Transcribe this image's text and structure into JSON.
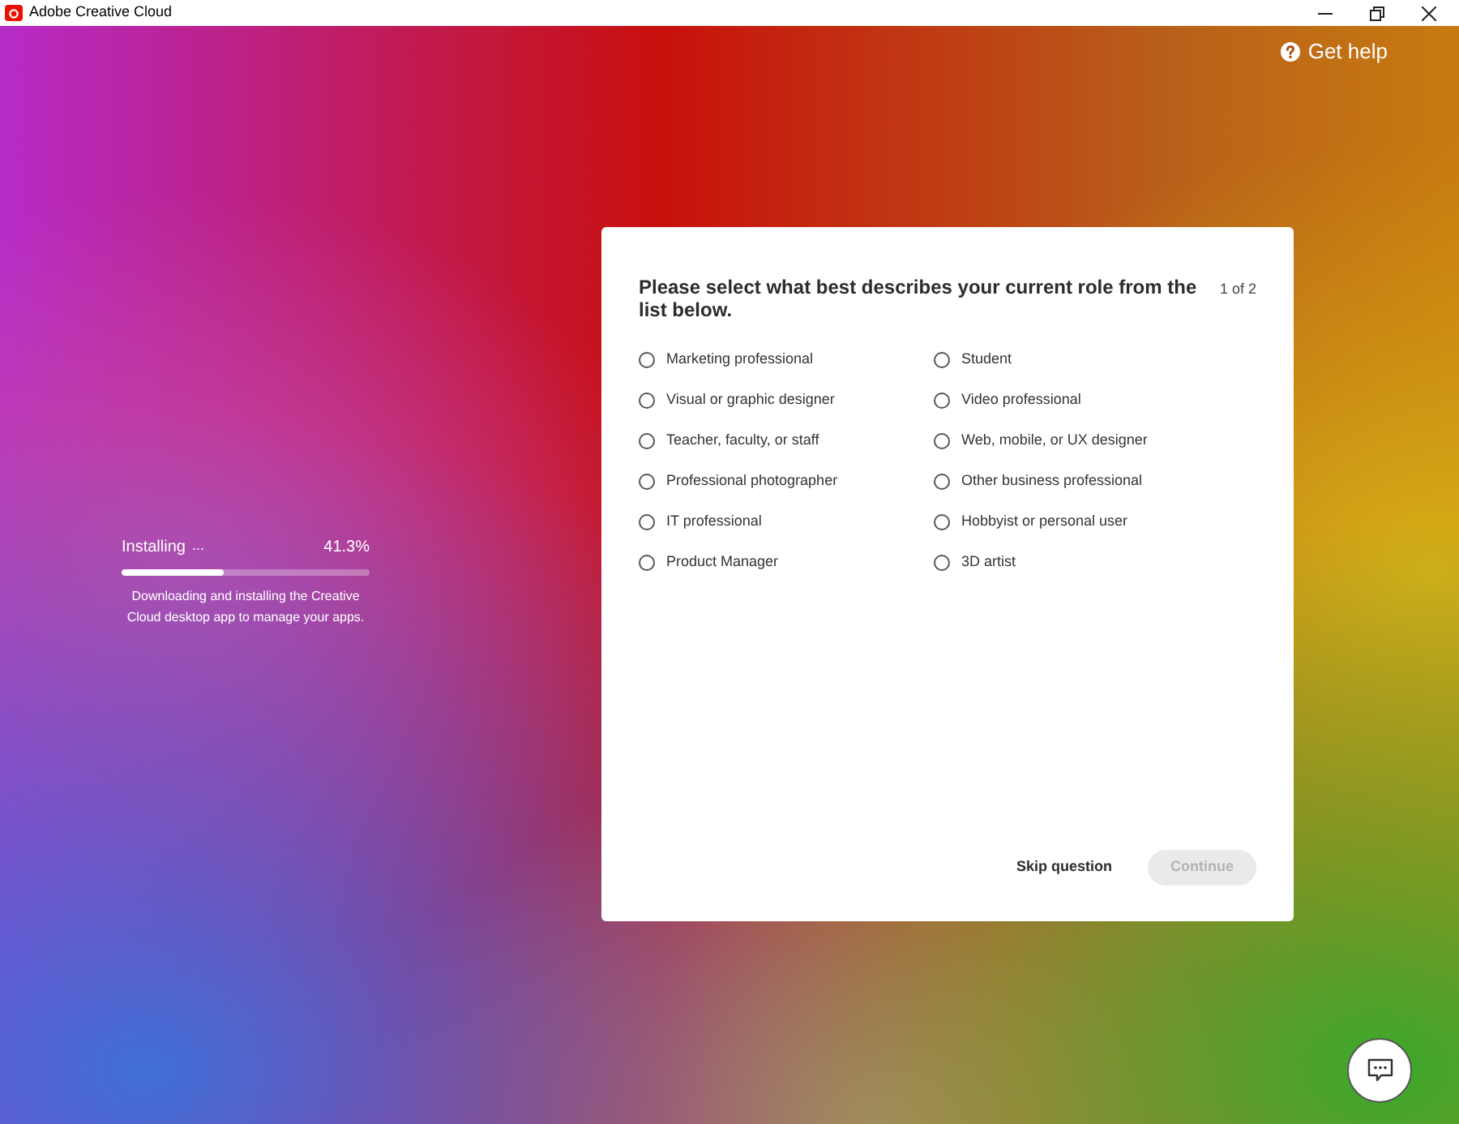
{
  "window": {
    "title": "Adobe Creative Cloud"
  },
  "help": {
    "label": "Get help"
  },
  "install": {
    "label": "Installing",
    "dots": "...",
    "percent": "41.3%",
    "level": 0.413,
    "description": "Downloading and installing the Creative Cloud desktop app to manage your apps."
  },
  "question": {
    "title": "Please select what best describes your current role from the list below.",
    "step": "1 of 2",
    "options": [
      {
        "label": "Marketing professional",
        "selected": false
      },
      {
        "label": "Visual or graphic designer",
        "selected": false
      },
      {
        "label": "Teacher, faculty, or staff",
        "selected": false
      },
      {
        "label": "Professional photographer",
        "selected": false
      },
      {
        "label": "IT professional",
        "selected": false
      },
      {
        "label": "Product Manager",
        "selected": false
      },
      {
        "label": "Student",
        "selected": false
      },
      {
        "label": "Video professional",
        "selected": false
      },
      {
        "label": "Web, mobile, or UX designer",
        "selected": false
      },
      {
        "label": "Other business professional",
        "selected": false
      },
      {
        "label": "Hobbyist or personal user",
        "selected": false
      },
      {
        "label": "3D artist",
        "selected": false
      }
    ],
    "skip": "Skip question",
    "continue": {
      "label": "Continue",
      "disabled": true
    }
  }
}
